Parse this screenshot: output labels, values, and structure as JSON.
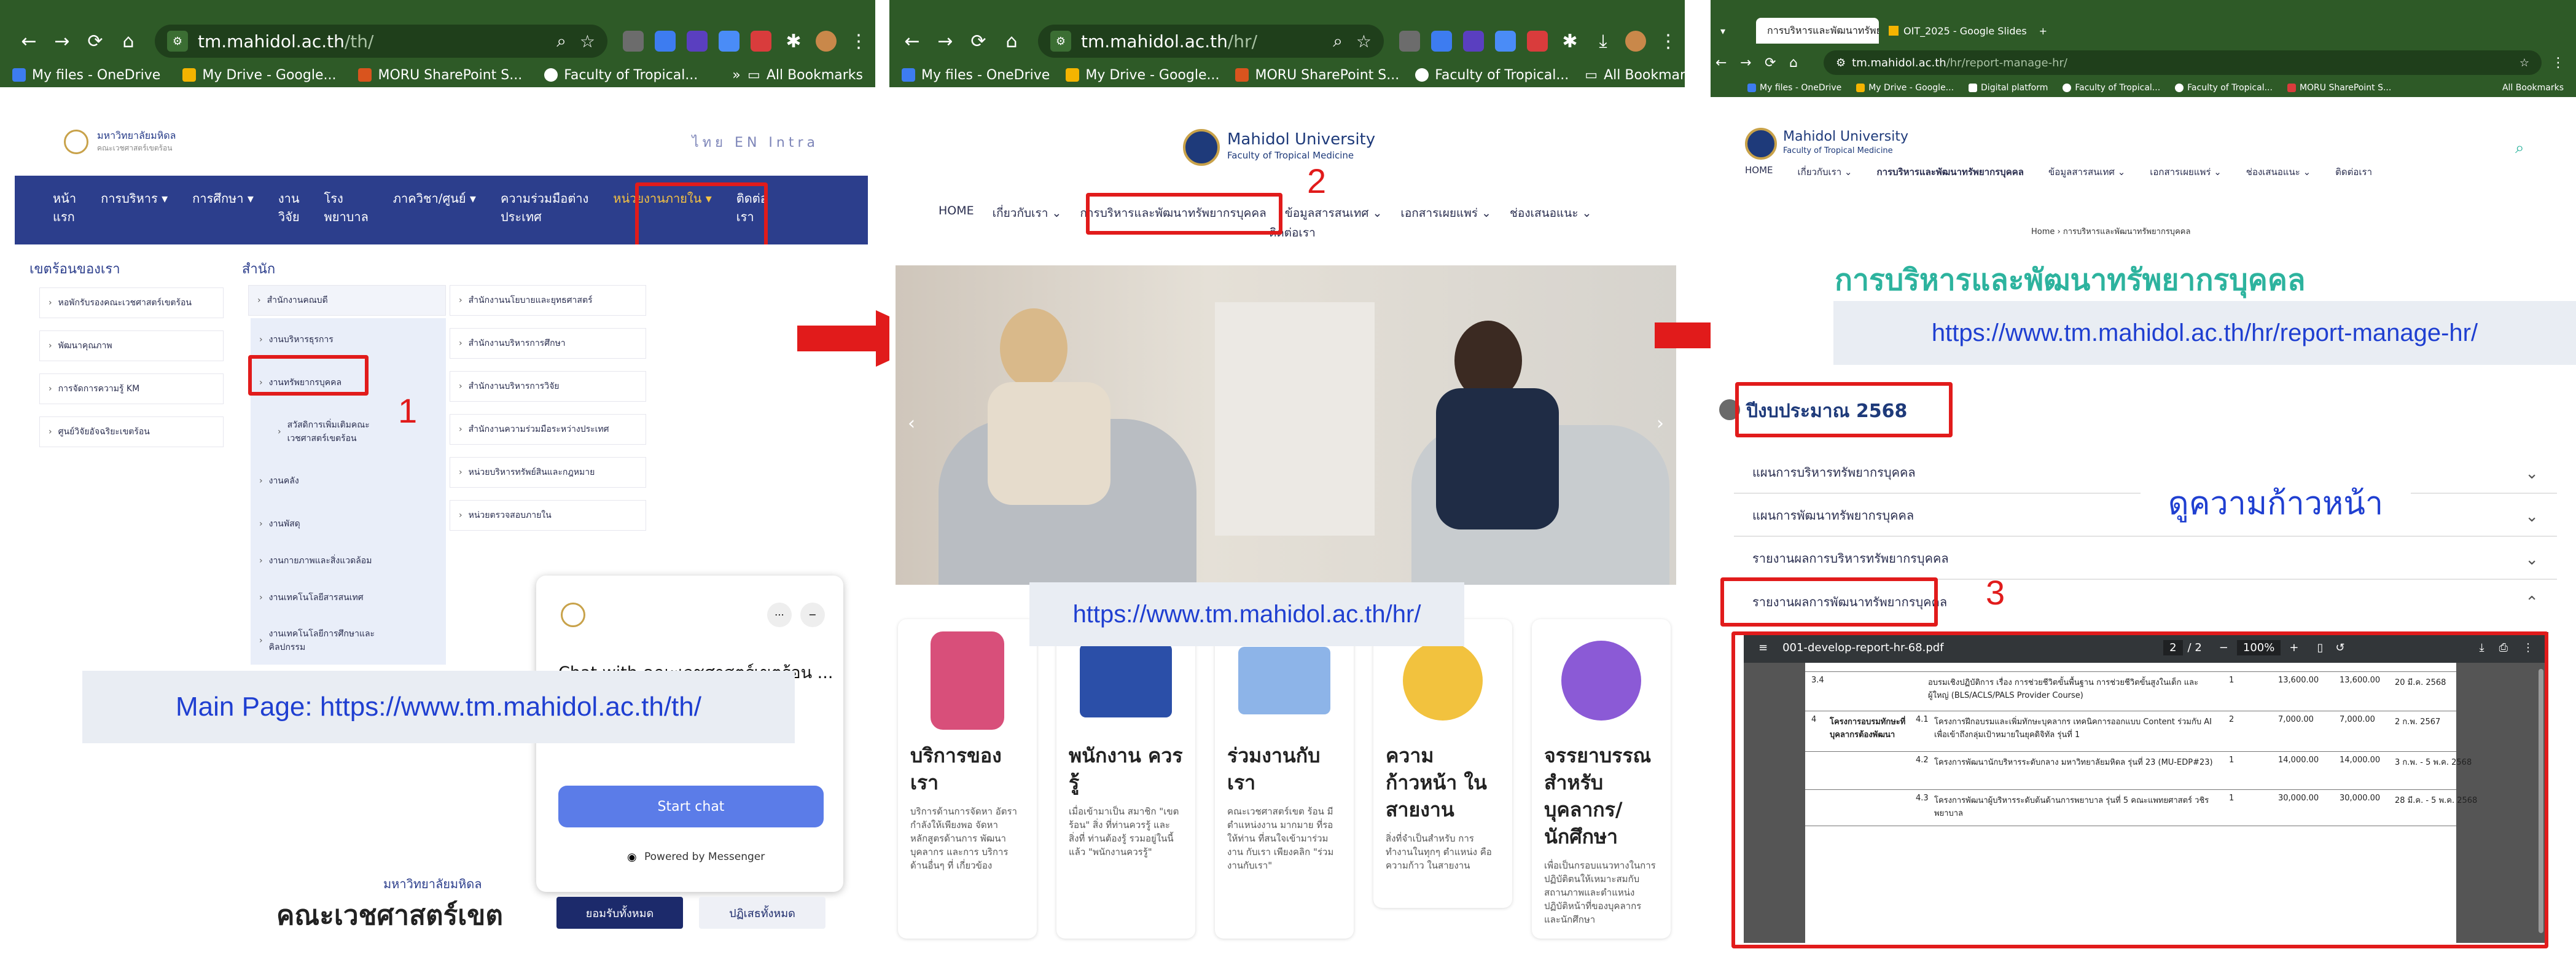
{
  "panels": [
    {
      "url": "tm.mahidol.ac.th/th/",
      "url_host": "tm.mahidol.ac.th",
      "url_path": "/th/"
    },
    {
      "url": "tm.mahidol.ac.th/hr/",
      "url_host": "tm.mahidol.ac.th",
      "url_path": "/hr/"
    },
    {
      "url": "tm.mahidol.ac.th/hr/report-manage-hr/",
      "url_host": "tm.mahidol.ac.th",
      "url_path": "/hr/report-manage-hr/"
    }
  ],
  "bookmarks": [
    "My files - OneDrive",
    "My Drive - Google...",
    "MORU SharePoint S...",
    "Faculty of Tropical..."
  ],
  "bookmarks_all": "All Bookmarks",
  "bookmarks3": [
    "My files - OneDrive",
    "My Drive - Google...",
    "Digital platform",
    "Faculty of Tropical...",
    "Faculty of Tropical...",
    "MORU SharePoint S..."
  ],
  "tabs3": {
    "active": "การบริหารและพัฒนาทรัพยากรบุคคล",
    "second": "OIT_2025 - Google Slides"
  },
  "p1": {
    "brand_line1": "มหาวิทยาลัยมหิดล",
    "brand_line2": "คณะเวชศาสตร์เขตร้อน",
    "lang": "ไทย  EN  Intra",
    "nav": [
      "หน้า\nแรก",
      "การบริหาร ▾",
      "การศึกษา ▾",
      "งาน\nวิจัย",
      "โรง\nพยาบาล",
      "ภาควิชา/ศูนย์ ▾",
      "ความร่วมมือต่าง\nประเทศ",
      "หน่วยงานภายใน ▾",
      "ติดต่อ\nเรา"
    ],
    "col1_head": "เขตร้อนของเรา",
    "col1": [
      "หอพักรับรองคณะเวชศาสตร์เขตร้อน",
      "พัฒนาคุณภาพ",
      "การจัดการความรู้ KM",
      "ศูนย์วิจัยอัจฉริยะเขตร้อน"
    ],
    "col2_head": "สำนัก",
    "col2_sub": "สำนักงานคณบดี",
    "col2": [
      "งานบริหารธุรการ",
      "งานทรัพยากรบุคคล",
      "สวัสดิการเพิ่มเติมคณะ\nเวชศาสตร์เขตร้อน",
      "งานคลัง",
      "งานพัสดุ",
      "งานกายภาพและสิ่งแวดล้อม",
      "งานเทคโนโลยีสารสนเทศ",
      "งานเทคโนโลยีการศึกษาและ\nคิลปกรรม"
    ],
    "col3": [
      "สำนักงานนโยบายและยุทธศาสตร์",
      "สำนักงานบริหารการศึกษา",
      "สำนักงานบริหารการวิจัย",
      "สำนักงานความร่วมมือระหว่างประเทศ",
      "หน่วยบริหารทรัพย์สินและกฎหมาย",
      "หน่วยตรวจสอบภายใน"
    ],
    "step": "1",
    "chat_title": "Chat with คณะเวชศาสตร์เขตร้อน ...",
    "chat_start": "Start chat",
    "chat_powered": "Powered by Messenger",
    "footer_small": "มหาวิทยาลัยมหิดล",
    "footer_title": "คณะเวชศาสตร์เขต",
    "btn_accept": "ยอมรับทั้งหมด",
    "btn_reject": "ปฏิเสธทั้งหมด",
    "main_label": "Main Page: https://www.tm.mahidol.ac.th/th/"
  },
  "p2": {
    "brand_line1": "Mahidol University",
    "brand_line2": "Faculty of Tropical Medicine",
    "menu": [
      "HOME",
      "เกี่ยวกับเรา ⌄",
      "การบริหารและพัฒนาทรัพยากรบุคคล",
      "ข้อมูลสารสนเทศ ⌄",
      "เอกสารเผยแพร่ ⌄",
      "ช่องเสนอแนะ ⌄"
    ],
    "menu_wrap": "ติดต่อเรา",
    "step": "2",
    "url_label": "https://www.tm.mahidol.ac.th/hr/",
    "cards": [
      {
        "title": "บริการของเรา",
        "text": "บริการด้านการจัดหา อัตรากำลังให้เพียงพอ จัดหาหลักสูตรด้านการ พัฒนาบุคลากร และการ บริการด้านอื่นๆ ที่ เกี่ยวข้อง"
      },
      {
        "title": "พนักงาน ควรรู้",
        "text": "เมื่อเข้ามาเป็น สมาชิก \"เขตร้อน\" สิ่ง ที่ท่านควรรู้ และ สิ่งที่ ท่านต้องรู้ รวมอยู่ในนี้ แล้ว \"พนักงานควรรู้\""
      },
      {
        "title": "ร่วมงานกับ เรา",
        "text": "คณะเวชศาสตร์เขต ร้อน มีตำแหน่งงาน มากมาย ที่รอให้ท่าน ที่สนใจเข้ามาร่วมงาน กับเรา เพียงคลิก \"ร่วมงานกับเรา\""
      },
      {
        "title": "ความก้าวหน้า ในสายงาน",
        "text": "สิ่งที่จำเป็นสำหรับ การทำงานในทุกๆ ตำแหน่ง คือความก้าว ในสายงาน"
      },
      {
        "title": "จรรยาบรรณ สำหรับ บุคลากร/ นักศึกษา",
        "text": "เพื่อเป็นกรอบแนวทางในการ ปฏิบัติตนให้เหมาะสมกับ สถานภาพและตำแหน่ง ปฏิบัติหน้าที่ของบุคลากร และนักศึกษา"
      }
    ]
  },
  "p3": {
    "brand_line1": "Mahidol University",
    "brand_line2": "Faculty of Tropical Medicine",
    "menu": [
      "HOME",
      "เกี่ยวกับเรา ⌄",
      "การบริหารและพัฒนาทรัพยากรบุคคล",
      "ข้อมูลสารสนเทศ ⌄",
      "เอกสารเผยแพร่ ⌄",
      "ช่องเสนอแนะ ⌄",
      "ติดต่อเรา"
    ],
    "breadcrumb": "Home  ›  การบริหารและพัฒนาทรัพยากรบุคคล",
    "page_title": "การบริหารและพัฒนาทรัพยากรบุคคล",
    "url_label": "https://www.tm.mahidol.ac.th/hr/report-manage-hr/",
    "fiscal_year": "ปีงบประมาณ 2568",
    "accordions": [
      "แผนการบริหารทรัพยากรบุคคล",
      "แผนการพัฒนาทรัพยากรบุคคล",
      "รายงานผลการบริหารทรัพยากรบุคคล",
      "รายงานผลการพัฒนาทรัพยากรบุคคล"
    ],
    "progress_label": "ดูความก้าวหน้า",
    "step": "3",
    "pdf": {
      "file": "001-develop-report-hr-68.pdf",
      "page": "2",
      "pages": "/ 2",
      "zoom": "100%"
    },
    "pdf_rows": [
      {
        "no": "3.4",
        "text": "อบรมเชิงปฏิบัติการ เรื่อง การช่วยชีวิตขั้นพื้นฐาน การช่วยชีวิตขั้นสูงในเด็ก และผู้ใหญ่ (BLS/ACLS/PALS Provider Course)",
        "qty": "1",
        "cost": "13,600.00",
        "total": "13,600.00",
        "date": "20 มี.ค. 2568"
      },
      {
        "no": "4",
        "group": "โครงการอบรมทักษะที่ บุคลากรต้องพัฒนา",
        "sub": "4.1",
        "text": "โครงการฝึกอบรมและเพิ่มทักษะบุคลากร เทคนิคการออกแบบ Content ร่วมกับ AI เพื่อเข้าถึงกลุ่มเป้าหมายในยุคดิจิทัล รุ่นที่ 1",
        "qty": "2",
        "cost": "7,000.00",
        "total": "7,000.00",
        "date": "2 ก.พ. 2567"
      },
      {
        "no": "4.2",
        "text": "โครงการพัฒนานักบริหารระดับกลาง มหาวิทยาลัยมหิดล รุ่นที่ 23 (MU-EDP#23)",
        "qty": "1",
        "cost": "14,000.00",
        "total": "14,000.00",
        "date": "3 ก.พ. - 5 พ.ค. 2568"
      },
      {
        "no": "4.3",
        "text": "โครงการพัฒนาผู้บริหารระดับต้นด้านการพยาบาล รุ่นที่ 5 คณะแพทยศาสตร์ วชิรพยาบาล",
        "qty": "1",
        "cost": "30,000.00",
        "total": "30,000.00",
        "date": "28 มี.ค. - 5 พ.ค. 2568"
      }
    ]
  },
  "colors": {
    "chrome": "#2e5a27",
    "accent_red": "#e11b1b",
    "nav_blue": "#2c3e8c",
    "title_green": "#2db39e",
    "url_blue": "#1f3fd1",
    "messenger": "#5b7ce8"
  }
}
